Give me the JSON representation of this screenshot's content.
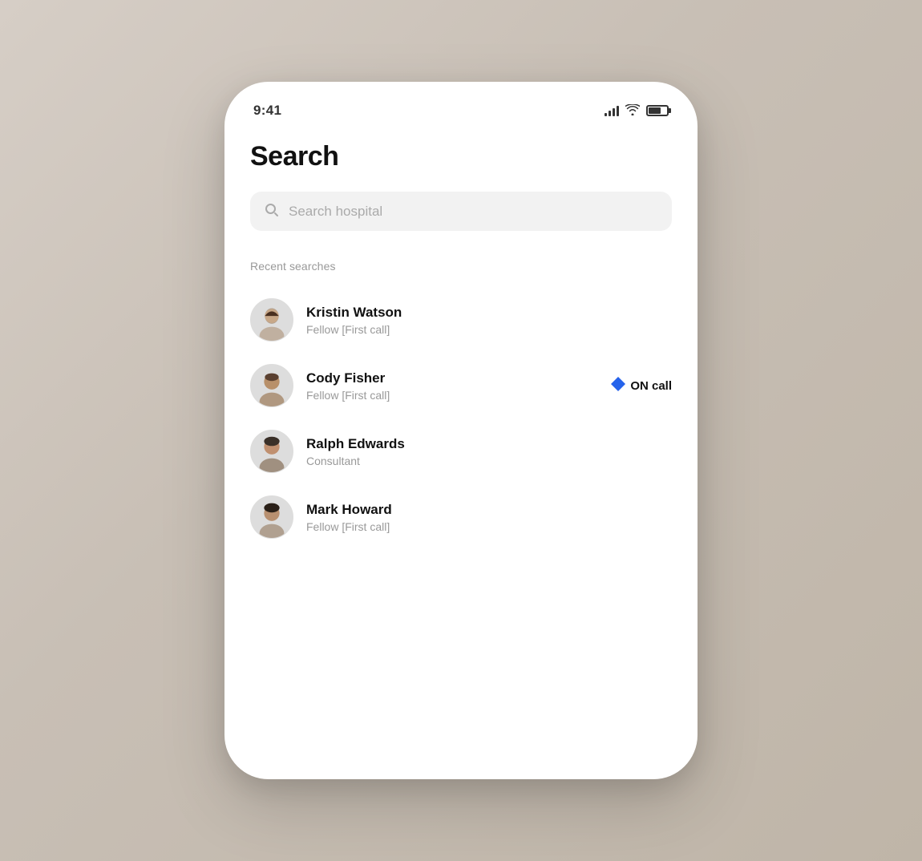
{
  "status_bar": {
    "time": "9:41",
    "signal_label": "signal",
    "wifi_label": "wifi",
    "battery_label": "battery"
  },
  "page": {
    "title": "Search",
    "search_placeholder": "Search hospital",
    "recent_label": "Recent searches"
  },
  "results": [
    {
      "id": 1,
      "name": "Kristin Watson",
      "role": "Fellow [First call]",
      "on_call": false,
      "avatar_color": "#c8bfb5"
    },
    {
      "id": 2,
      "name": "Cody Fisher",
      "role": "Fellow [First call]",
      "on_call": true,
      "on_call_label": "ON call",
      "avatar_color": "#b0a898"
    },
    {
      "id": 3,
      "name": "Ralph Edwards",
      "role": "Consultant",
      "on_call": false,
      "avatar_color": "#a89888"
    },
    {
      "id": 4,
      "name": "Mark Howard",
      "role": "Fellow [First call]",
      "on_call": false,
      "avatar_color": "#b8a898"
    }
  ],
  "icons": {
    "search": "🔍",
    "diamond": "◆"
  }
}
